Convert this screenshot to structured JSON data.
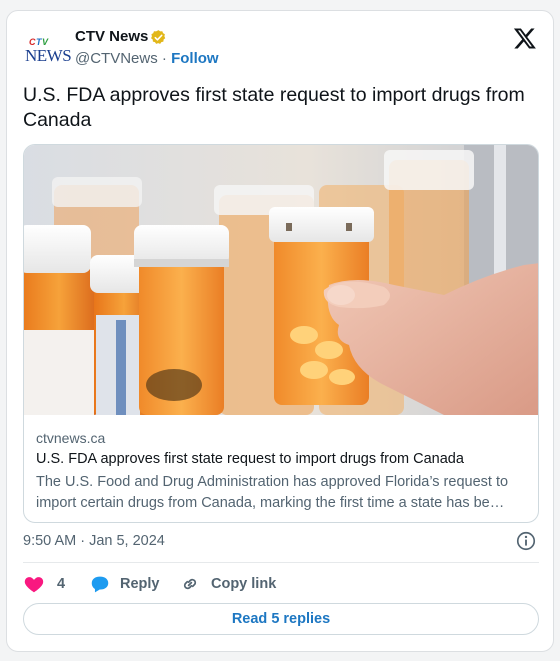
{
  "author": {
    "name": "CTV News",
    "handle": "@CTVNews",
    "separator": "·",
    "follow_label": "Follow",
    "logo_ctv": "CTV",
    "logo_news": "NEWS"
  },
  "tweet": {
    "text": "U.S. FDA approves first state request to import drugs from Canada"
  },
  "link_card": {
    "domain": "ctvnews.ca",
    "title": "U.S. FDA approves first state request to import drugs from Canada",
    "description": "The U.S. Food and Drug Administration has approved Florida’s request to import certain drugs from Canada, marking the first time a state has be…"
  },
  "timestamp": "9:50 AM · Jan 5, 2024",
  "actions": {
    "like_count": "4",
    "reply_label": "Reply",
    "copy_link_label": "Copy link"
  },
  "read_replies_label": "Read 5 replies",
  "icons": {
    "verified": "verified-badge-icon",
    "x_logo": "x-logo-icon",
    "info": "info-icon",
    "heart": "heart-icon",
    "reply": "reply-bubble-icon",
    "link": "link-icon"
  },
  "colors": {
    "accent": "#1d77c2",
    "heart": "#f91880",
    "verified_gold": "#e2b719",
    "secondary_text": "#536471"
  }
}
